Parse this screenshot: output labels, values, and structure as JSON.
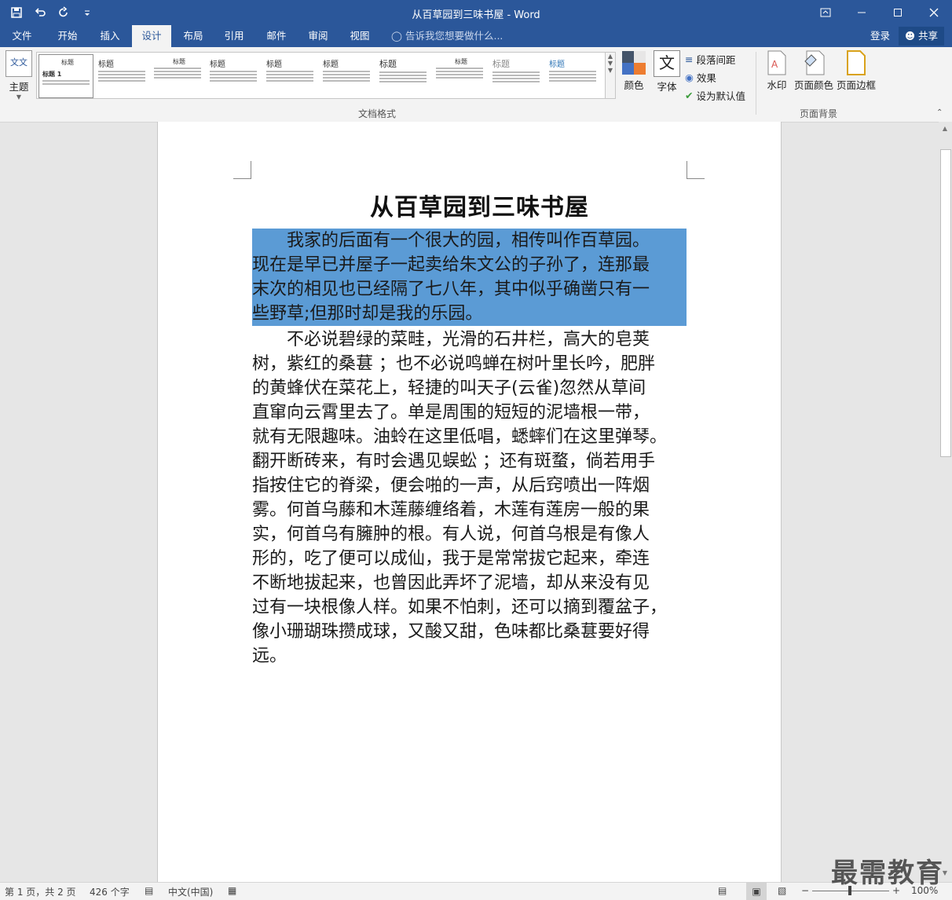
{
  "window": {
    "title": "从百草园到三味书屋 - Word"
  },
  "tabs": [
    "文件",
    "开始",
    "插入",
    "设计",
    "布局",
    "引用",
    "邮件",
    "审阅",
    "视图"
  ],
  "active_tab": "设计",
  "tell_me_placeholder": "告诉我您想要做什么...",
  "account": {
    "signin": "登录",
    "share": "共享"
  },
  "ribbon": {
    "theme_label": "主题",
    "theme_icon_text": "文文",
    "doc_format_group": "文档格式",
    "gallery_titles": [
      "标题",
      "标题",
      "标题",
      "标题",
      "标题",
      "标题",
      "标题",
      "标题",
      "标题",
      "标题"
    ],
    "gallery_heading1": "标题 1",
    "colors_label": "颜色",
    "fonts_label": "字体",
    "fonts_icon_text": "文",
    "paragraph_spacing": "段落间距",
    "effects": "效果",
    "set_default": "设为默认值",
    "watermark": "水印",
    "page_color": "页面颜色",
    "page_border": "页面边框",
    "page_bg_group": "页面背景"
  },
  "document": {
    "title": "从百草园到三味书屋",
    "para1_lines": [
      "　　我家的后面有一个很大的园，相传叫作百草园。",
      "现在是早已并屋子一起卖给朱文公的子孙了，连那最",
      "末次的相见也已经隔了七八年，其中似乎确凿只有一",
      "些野草;但那时却是我的乐园。"
    ],
    "para2_lines": [
      "　　不必说碧绿的菜畦，光滑的石井栏，高大的皂荚",
      "树，紫红的桑葚 ；也不必说鸣蝉在树叶里长吟，肥胖",
      "的黄蜂伏在菜花上，轻捷的叫天子(云雀)忽然从草间",
      "直窜向云霄里去了。单是周围的短短的泥墙根一带，",
      "就有无限趣味。油蛉在这里低唱，蟋蟀们在这里弹琴。",
      "翻开断砖来，有时会遇见蜈蚣 ；还有斑蝥，倘若用手",
      "指按住它的脊梁，便会啪的一声，从后窍喷出一阵烟",
      "雾。何首乌藤和木莲藤缠络着，木莲有莲房一般的果",
      "实，何首乌有臃肿的根。有人说，何首乌根是有像人",
      "形的，吃了便可以成仙，我于是常常拔它起来，牵连",
      "不断地拔起来，也曾因此弄坏了泥墙，却从来没有见",
      "过有一块根像人样。如果不怕刺，还可以摘到覆盆子，",
      "像小珊瑚珠攒成球，又酸又甜，色味都比桑葚要好得",
      "远。"
    ]
  },
  "status": {
    "page": "第 1 页，共 2 页",
    "words": "426 个字",
    "language": "中文(中国)",
    "zoom": "100%"
  },
  "watermark_text": "最需教育",
  "colors": {
    "accent": "#2b579a",
    "selection": "#5b9bd5"
  }
}
